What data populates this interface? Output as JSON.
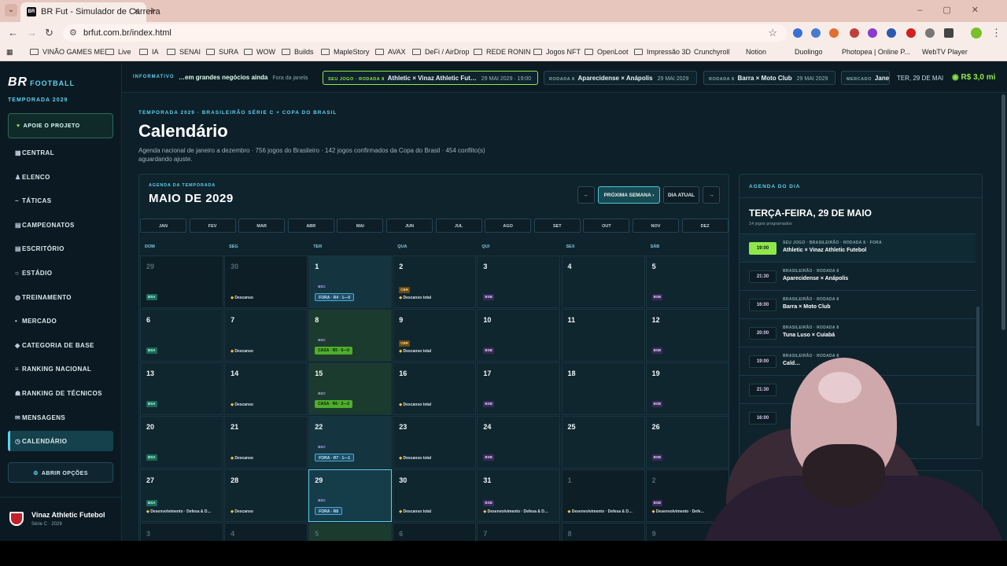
{
  "browser": {
    "tab_title": "BR Fut - Simulador de Carreira",
    "url": "brfut.com.br/index.html",
    "bookmarks": [
      "VINÃO GAMES MEI",
      "Live",
      "IA",
      "SENAI",
      "SURA",
      "WOW",
      "Builds",
      "MapleStory",
      "AVAX",
      "DeFi / AirDrop",
      "REDE RONIN",
      "Jogos NFT",
      "OpenLoot",
      "Impressão 3D",
      "Crunchyroll",
      "Notion",
      "Duolingo",
      "Photopea | Online P...",
      "WebTV Player"
    ]
  },
  "sidebar": {
    "logo": "BR",
    "logo_suffix": "FOOTBALL",
    "season": "TEMPORADA 2029",
    "support": "APOIE O PROJETO",
    "items": [
      {
        "label": "CENTRAL",
        "icon": "grid-icon"
      },
      {
        "label": "ELENCO",
        "icon": "person-icon"
      },
      {
        "label": "TÁTICAS",
        "icon": "tactics-icon"
      },
      {
        "label": "CAMPEONATOS",
        "icon": "trophy-icon"
      },
      {
        "label": "ESCRITÓRIO",
        "icon": "office-icon"
      },
      {
        "label": "ESTÁDIO",
        "icon": "stadium-icon"
      },
      {
        "label": "TREINAMENTO",
        "icon": "training-icon"
      },
      {
        "label": "MERCADO",
        "icon": "market-icon"
      },
      {
        "label": "CATEGORIA DE BASE",
        "icon": "youth-icon"
      },
      {
        "label": "RANKING NACIONAL",
        "icon": "ranking-icon"
      },
      {
        "label": "RANKING DE TÉCNICOS",
        "icon": "coach-icon"
      },
      {
        "label": "MENSAGENS",
        "icon": "mail-icon"
      },
      {
        "label": "CALENDÁRIO",
        "icon": "calendar-icon",
        "active": true
      }
    ],
    "options": "ABRIR OPÇÕES",
    "club_name": "Vinaz Athletic Futebol",
    "club_sub": "Série C · 2029"
  },
  "ticker": {
    "label": "INFORMATIVO",
    "news": "…em grandes negócios ainda",
    "news_tag": "Fora da janela",
    "items": [
      {
        "tag": "SEU JOGO · RODADA 8",
        "text": "Athletic × Vinaz Athletic Fut…",
        "date": "29 MAI 2029 · 19:00",
        "highlight": true
      },
      {
        "tag": "RODADA 8",
        "text": "Aparecidense × Anápolis",
        "date": "29 MAI 2029"
      },
      {
        "tag": "RODADA 8",
        "text": "Barra × Moto Club",
        "date": "29 MAI 2029"
      },
      {
        "tag": "MERCADO",
        "text": "Jane…",
        "date": ""
      }
    ],
    "today": "TER, 29 DE MAI",
    "money": "R$ 3,0 mi"
  },
  "page": {
    "crumb": "TEMPORADA 2029 · BRASILEIRÃO SÉRIE C + COPA DO BRASIL",
    "title": "Calendário",
    "subtitle": "Agenda nacional de janeiro a dezembro · 756 jogos do Brasileiro · 142 jogos confirmados da Copa do Brasil · 454 conflito(s) aguardando ajuste."
  },
  "calendar": {
    "kicker": "AGENDA DA TEMPORADA",
    "month": "MAIO DE 2029",
    "prev": "←",
    "next_week": "PRÓXIMA SEMANA ›",
    "today": "DIA ATUAL",
    "next": "→",
    "months": [
      "JAN",
      "FEV",
      "MAR",
      "ABR",
      "MAI",
      "JUN",
      "JUL",
      "AGO",
      "SET",
      "OUT",
      "NOV",
      "DEZ"
    ],
    "weekdays": [
      "DOM",
      "SEG",
      "TER",
      "QUA",
      "QUI",
      "SEX",
      "SÁB"
    ],
    "weeks": [
      [
        {
          "n": "29",
          "prev": true,
          "badge": "BSA"
        },
        {
          "n": "30",
          "prev": true,
          "rest": "Descanso"
        },
        {
          "n": "1",
          "bsc": true,
          "game": "FORA · R4 · 1—0",
          "gtype": "away"
        },
        {
          "n": "2",
          "cbr": true,
          "rest": "Descanso total"
        },
        {
          "n": "3",
          "badge": "BSB"
        },
        {
          "n": "4"
        },
        {
          "n": "5",
          "badge": "BSB"
        }
      ],
      [
        {
          "n": "6",
          "badge": "BSA"
        },
        {
          "n": "7",
          "rest": "Descanso"
        },
        {
          "n": "8",
          "bsc": true,
          "game": "CASA · R5 · 6—0",
          "gtype": "home"
        },
        {
          "n": "9",
          "cbr": true,
          "rest": "Descanso total"
        },
        {
          "n": "10",
          "badge": "BSB"
        },
        {
          "n": "11"
        },
        {
          "n": "12",
          "badge": "BSB"
        }
      ],
      [
        {
          "n": "13",
          "badge": "BSA"
        },
        {
          "n": "14",
          "rest": "Descanso"
        },
        {
          "n": "15",
          "bsc": true,
          "game": "CASA · R6 · 2—2",
          "gtype": "home"
        },
        {
          "n": "16",
          "rest": "Descanso total"
        },
        {
          "n": "17",
          "badge": "BSB"
        },
        {
          "n": "18"
        },
        {
          "n": "19",
          "badge": "BSB"
        }
      ],
      [
        {
          "n": "20",
          "badge": "BSA"
        },
        {
          "n": "21",
          "rest": "Descanso"
        },
        {
          "n": "22",
          "bsc": true,
          "game": "FORA · R7 · 1—1",
          "gtype": "away"
        },
        {
          "n": "23",
          "rest": "Descanso total"
        },
        {
          "n": "24",
          "badge": "BSB"
        },
        {
          "n": "25"
        },
        {
          "n": "26",
          "badge": "BSB"
        }
      ],
      [
        {
          "n": "27",
          "badge": "BSA",
          "rest": "Desenvolvimento · Defesa & D…"
        },
        {
          "n": "28",
          "rest": "Descanso"
        },
        {
          "n": "29",
          "bsc": true,
          "today": true,
          "game": "FORA · R8",
          "gtype": "away"
        },
        {
          "n": "30",
          "rest": "Descanso total"
        },
        {
          "n": "31",
          "badge": "BSB",
          "rest": "Desenvolvimento · Defesa & D…"
        },
        {
          "n": "1",
          "prev": true,
          "rest": "Desenvolvimento · Defesa & D…"
        },
        {
          "n": "2",
          "prev": true,
          "badge": "BSB",
          "rest": "Desenvolvimento · Defe…"
        }
      ],
      [
        {
          "n": "3",
          "prev": true
        },
        {
          "n": "4",
          "prev": true
        },
        {
          "n": "5",
          "prev": true,
          "home": true
        },
        {
          "n": "6",
          "prev": true
        },
        {
          "n": "7",
          "prev": true
        },
        {
          "n": "8",
          "prev": true
        },
        {
          "n": "9",
          "prev": true
        }
      ]
    ]
  },
  "agenda": {
    "header": "AGENDA DO DIA",
    "date": "TERÇA-FEIRA, 29 DE MAIO",
    "count": "14 jogos programados",
    "items": [
      {
        "time": "19:00",
        "meta": "SEU JOGO · BRASILEIRÃO · RODADA 8 · FORA",
        "game": "Athletic × Vinaz Athletic Futebol"
      },
      {
        "time": "21:30",
        "meta": "BRASILEIRÃO · RODADA 8",
        "game": "Aparecidense × Anápolis"
      },
      {
        "time": "16:00",
        "meta": "BRASILEIRÃO · RODADA 8",
        "game": "Barra × Moto Club"
      },
      {
        "time": "20:00",
        "meta": "BRASILEIRÃO · RODADA 8",
        "game": "Tuna Luso × Cuiabá"
      },
      {
        "time": "19:00",
        "meta": "BRASILEIRÃO · RODADA 8",
        "game": "Cald…"
      },
      {
        "time": "21:30",
        "meta": "",
        "game": ""
      },
      {
        "time": "16:00",
        "meta": "",
        "game": ""
      }
    ]
  },
  "colors": {
    "accent": "#5fd0ef",
    "money": "#8fe84a",
    "bg": "#0d1f28"
  }
}
